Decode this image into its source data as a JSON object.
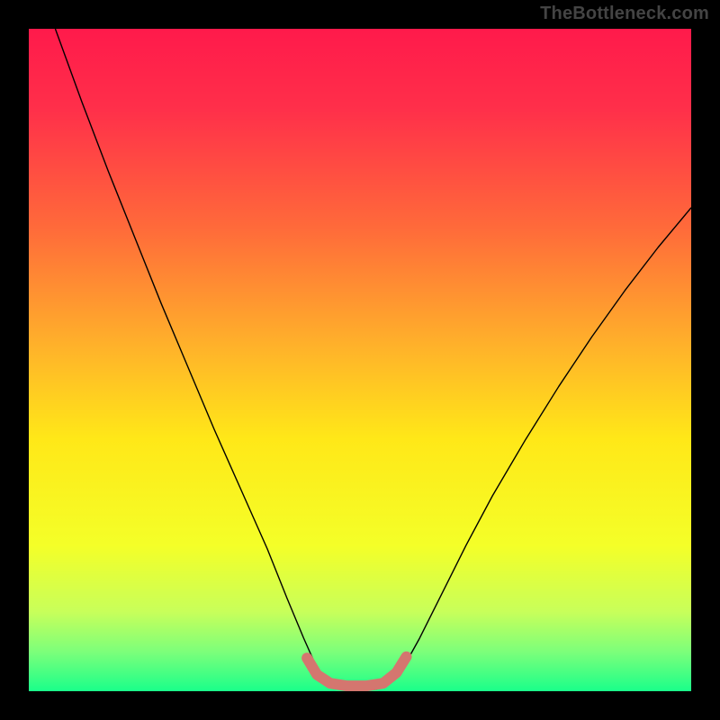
{
  "watermark": "TheBottleneck.com",
  "chart_data": {
    "type": "line",
    "title": "",
    "xlabel": "",
    "ylabel": "",
    "xlim": [
      0,
      100
    ],
    "ylim": [
      0,
      100
    ],
    "background_gradient": {
      "stops": [
        {
          "offset": 0.0,
          "color": "#ff1a4b"
        },
        {
          "offset": 0.12,
          "color": "#ff2f4a"
        },
        {
          "offset": 0.3,
          "color": "#ff6a3a"
        },
        {
          "offset": 0.48,
          "color": "#ffb22a"
        },
        {
          "offset": 0.62,
          "color": "#ffe818"
        },
        {
          "offset": 0.78,
          "color": "#f4ff28"
        },
        {
          "offset": 0.88,
          "color": "#c8ff5a"
        },
        {
          "offset": 0.94,
          "color": "#7dff7a"
        },
        {
          "offset": 1.0,
          "color": "#1aff8a"
        }
      ]
    },
    "series": [
      {
        "name": "bottleneck-curve",
        "color": "#000000",
        "width": 1.4,
        "points": [
          {
            "x": 4.0,
            "y": 100.0
          },
          {
            "x": 8.0,
            "y": 89.0
          },
          {
            "x": 12.0,
            "y": 78.5
          },
          {
            "x": 16.0,
            "y": 68.5
          },
          {
            "x": 20.0,
            "y": 58.5
          },
          {
            "x": 24.0,
            "y": 49.0
          },
          {
            "x": 28.0,
            "y": 39.5
          },
          {
            "x": 32.0,
            "y": 30.5
          },
          {
            "x": 36.0,
            "y": 21.5
          },
          {
            "x": 39.0,
            "y": 14.0
          },
          {
            "x": 41.5,
            "y": 8.0
          },
          {
            "x": 43.5,
            "y": 3.5
          },
          {
            "x": 45.0,
            "y": 1.0
          },
          {
            "x": 47.5,
            "y": 0.3
          },
          {
            "x": 50.0,
            "y": 0.2
          },
          {
            "x": 52.5,
            "y": 0.3
          },
          {
            "x": 54.5,
            "y": 1.2
          },
          {
            "x": 56.5,
            "y": 3.5
          },
          {
            "x": 59.0,
            "y": 8.0
          },
          {
            "x": 62.0,
            "y": 14.0
          },
          {
            "x": 66.0,
            "y": 22.0
          },
          {
            "x": 70.0,
            "y": 29.5
          },
          {
            "x": 75.0,
            "y": 38.0
          },
          {
            "x": 80.0,
            "y": 46.0
          },
          {
            "x": 85.0,
            "y": 53.5
          },
          {
            "x": 90.0,
            "y": 60.5
          },
          {
            "x": 95.0,
            "y": 67.0
          },
          {
            "x": 100.0,
            "y": 73.0
          }
        ]
      },
      {
        "name": "optimal-range-marker",
        "color": "#d4766f",
        "width": 12,
        "cap": "round",
        "points": [
          {
            "x": 42.0,
            "y": 5.0
          },
          {
            "x": 43.5,
            "y": 2.5
          },
          {
            "x": 45.5,
            "y": 1.2
          },
          {
            "x": 48.0,
            "y": 0.8
          },
          {
            "x": 51.0,
            "y": 0.8
          },
          {
            "x": 53.5,
            "y": 1.2
          },
          {
            "x": 55.5,
            "y": 2.8
          },
          {
            "x": 57.0,
            "y": 5.2
          }
        ]
      }
    ]
  }
}
